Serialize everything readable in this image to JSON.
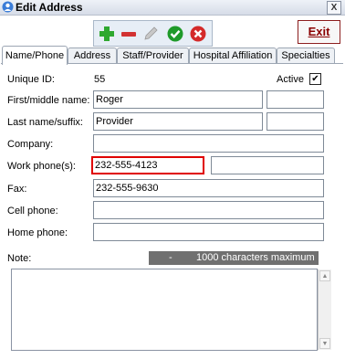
{
  "window": {
    "title": "Edit Address",
    "close_label": "X"
  },
  "toolbar": {
    "buttons": [
      {
        "name": "add-button",
        "icon": "plus-icon",
        "color": "#2fa82f"
      },
      {
        "name": "remove-button",
        "icon": "minus-icon",
        "color": "#d23232"
      },
      {
        "name": "edit-button",
        "icon": "pencil-icon",
        "color": "#b0b0b0"
      },
      {
        "name": "confirm-button",
        "icon": "check-icon",
        "color": "#1f9a2a"
      },
      {
        "name": "cancel-button",
        "icon": "x-icon",
        "color": "#d42a2a"
      }
    ],
    "exit_label": "Exit"
  },
  "tabs": [
    {
      "label": "Name/Phone",
      "active": true
    },
    {
      "label": "Address"
    },
    {
      "label": "Staff/Provider"
    },
    {
      "label": "Hospital Affiliation"
    },
    {
      "label": "Specialties"
    }
  ],
  "form": {
    "unique_id_label": "Unique ID:",
    "unique_id_value": "55",
    "active_label": "Active",
    "active_checked": true,
    "first_name_label": "First/middle name:",
    "first_name_value": "Roger",
    "middle_name_value": "",
    "last_name_label": "Last name/suffix:",
    "last_name_value": "Provider",
    "suffix_value": "",
    "company_label": "Company:",
    "company_value": "",
    "work_phone_label": "Work phone(s):",
    "work_phone_value": "232-555-4123",
    "work_phone2_value": "",
    "fax_label": "Fax:",
    "fax_value": "232-555-9630",
    "cell_label": "Cell phone:",
    "cell_value": "",
    "home_label": "Home phone:",
    "home_value": "",
    "note_label": "Note:",
    "note_counter_dash": "-",
    "note_counter_text": "1000 characters maximum",
    "note_value": ""
  },
  "colors": {
    "highlight": "#e00000",
    "exit_text": "#8a0000",
    "counter_bg": "#707070"
  }
}
